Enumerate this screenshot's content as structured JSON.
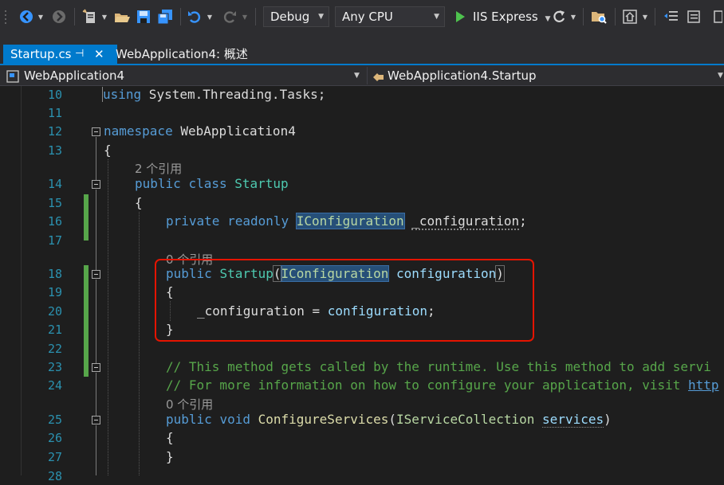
{
  "toolbar": {
    "config": "Debug",
    "platform": "Any CPU",
    "run_target": "IIS Express",
    "icons": [
      "back-icon",
      "forward-icon",
      "new-project-icon",
      "open-folder-icon",
      "save-icon",
      "save-all-icon",
      "undo-icon",
      "redo-icon",
      "run-icon",
      "refresh-icon",
      "find-in-files-icon",
      "home-icon",
      "outdent-icon",
      "comment-icon"
    ]
  },
  "tabs": [
    {
      "label": "Startup.cs",
      "active": true
    },
    {
      "label": "WebApplication4: 概述",
      "active": false
    }
  ],
  "nav": {
    "project": "WebApplication4",
    "type": "WebApplication4.Startup"
  },
  "lines": {
    "n10": "10",
    "n11": "11",
    "n12": "12",
    "n13": "13",
    "n14": "14",
    "n15": "15",
    "n16": "16",
    "n17": "17",
    "n18": "18",
    "n19": "19",
    "n20": "20",
    "n21": "21",
    "n22": "22",
    "n23": "23",
    "n24": "24",
    "n25": "25",
    "n26": "26",
    "n27": "27",
    "n28": "28"
  },
  "code": {
    "using_kw": "using",
    "using_ns": " System.Threading.Tasks;",
    "namespace_kw": "namespace",
    "namespace_name": " WebApplication4",
    "brace_open": "{",
    "brace_close": "}",
    "lens_class": "2 个引用",
    "public": "public",
    "class": "class",
    "startup": "Startup",
    "private": "private",
    "readonly": "readonly",
    "iconfiguration": "IConfiguration",
    "field": "_configuration",
    "semicolon": ";",
    "lens_ctor": "0 个引用",
    "paren_open": "(",
    "paren_close": ")",
    "param": "configuration",
    "assign": " = ",
    "comment1": "// This method gets called by the runtime. Use this method to add servi",
    "comment2_pre": "// For more information on how to configure your application, visit ",
    "comment2_link": "http",
    "lens_method": "0 个引用",
    "void": "void",
    "configure_services": "ConfigureServices",
    "iservicecollection": "IServiceCollection",
    "services": "services"
  }
}
